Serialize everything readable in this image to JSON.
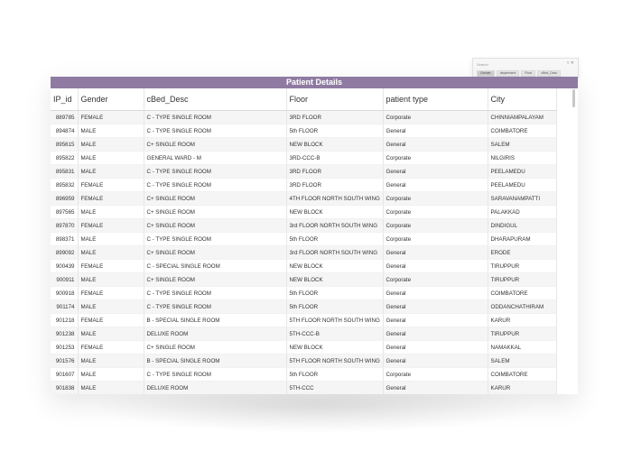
{
  "report": {
    "title": "Patient Details",
    "columns": [
      "IP_id",
      "Gender",
      "cBed_Desc",
      "Floor",
      "patient type",
      "City"
    ],
    "rows": [
      [
        "889785",
        "FEMALE",
        "C - TYPE SINGLE ROOM",
        "3RD FLOOR",
        "Corporate",
        "CHINNIAMPALAYAM"
      ],
      [
        "894874",
        "MALE",
        "C - TYPE SINGLE ROOM",
        "5th FLOOR",
        "General",
        "COIMBATORE"
      ],
      [
        "895615",
        "MALE",
        "C+ SINGLE ROOM",
        "NEW BLOCK",
        "General",
        "SALEM"
      ],
      [
        "895822",
        "MALE",
        "GENERAL WARD - M",
        "3RD-CCC-B",
        "Corporate",
        "NILGIRIS"
      ],
      [
        "895831",
        "MALE",
        "C - TYPE SINGLE ROOM",
        "3RD FLOOR",
        "General",
        "PEELAMEDU"
      ],
      [
        "895832",
        "FEMALE",
        "C - TYPE SINGLE ROOM",
        "3RD FLOOR",
        "General",
        "PEELAMEDU"
      ],
      [
        "896959",
        "FEMALE",
        "C+ SINGLE ROOM",
        "4TH FLOOR NORTH SOUTH WING",
        "Corporate",
        "SARAVANAMPATTI"
      ],
      [
        "897565",
        "MALE",
        "C+ SINGLE ROOM",
        "NEW BLOCK",
        "Corporate",
        "PALAKKAD"
      ],
      [
        "897870",
        "FEMALE",
        "C+ SINGLE ROOM",
        "3rd FLOOR NORTH SOUTH WING",
        "Corporate",
        "DINDIGUL"
      ],
      [
        "898371",
        "MALE",
        "C - TYPE SINGLE ROOM",
        "5th FLOOR",
        "Corporate",
        "DHARAPURAM"
      ],
      [
        "899092",
        "MALE",
        "C+ SINGLE ROOM",
        "3rd FLOOR NORTH SOUTH WING",
        "General",
        "ERODE"
      ],
      [
        "900439",
        "FEMALE",
        "C - SPECIAL SINGLE ROOM",
        "NEW BLOCK",
        "General",
        "TIRUPPUR"
      ],
      [
        "900911",
        "MALE",
        "C+ SINGLE ROOM",
        "NEW BLOCK",
        "Corporate",
        "TIRUPPUR"
      ],
      [
        "900918",
        "FEMALE",
        "C - TYPE SINGLE ROOM",
        "5th FLOOR",
        "General",
        "COIMBATORE"
      ],
      [
        "901174",
        "MALE",
        "C - TYPE SINGLE ROOM",
        "5th FLOOR",
        "General",
        "ODDANCHATHIRAM"
      ],
      [
        "901218",
        "FEMALE",
        "B - SPECIAL SINGLE ROOM",
        "5TH FLOOR NORTH SOUTH WING",
        "General",
        "KARUR"
      ],
      [
        "901238",
        "MALE",
        "DELUXE ROOM",
        "5TH-CCC-B",
        "General",
        "TIRUPPUR"
      ],
      [
        "901253",
        "FEMALE",
        "C+ SINGLE ROOM",
        "NEW BLOCK",
        "General",
        "NAMAKKAL"
      ],
      [
        "901576",
        "MALE",
        "B - SPECIAL SINGLE ROOM",
        "5TH FLOOR NORTH SOUTH WING",
        "General",
        "SALEM"
      ],
      [
        "901607",
        "MALE",
        "C - TYPE SINGLE ROOM",
        "5th FLOOR",
        "Corporate",
        "COIMBATORE"
      ],
      [
        "901838",
        "MALE",
        "DELUXE ROOM",
        "5TH-CCC",
        "General",
        "KARUR"
      ]
    ]
  },
  "filter_panel": {
    "search_placeholder": "Search",
    "icons": [
      "filter-icon",
      "close-icon"
    ],
    "tabs": [
      "Gender",
      "department",
      "Floor",
      "cBed_Desc"
    ]
  },
  "colors": {
    "title_bar": "#8f7ba2",
    "stripe": "#f5f5f5"
  }
}
